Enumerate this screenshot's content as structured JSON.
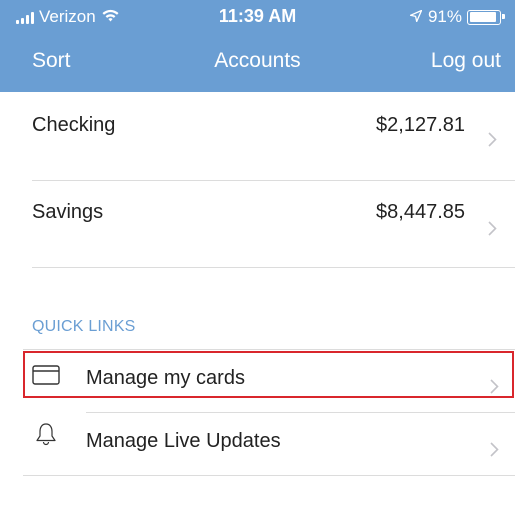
{
  "status_bar": {
    "carrier": "Verizon",
    "time": "11:39 AM",
    "battery": "91%",
    "battery_level": 0.91,
    "signal_icon": "signal-bars-icon",
    "wifi_icon": "wifi-icon",
    "location_icon": "location-arrow-icon",
    "battery_icon": "battery-icon"
  },
  "nav": {
    "left_label": "Sort",
    "title": "Accounts",
    "right_label": "Log out"
  },
  "accounts": [
    {
      "name": "Checking",
      "balance": "$2,127.81"
    },
    {
      "name": "Savings",
      "balance": "$8,447.85"
    }
  ],
  "quick_links": {
    "header": "QUICK LINKS",
    "items": [
      {
        "label": "Manage my cards",
        "icon": "credit-card-icon"
      },
      {
        "label": "Manage Live Updates",
        "icon": "bell-icon"
      }
    ]
  },
  "colors": {
    "header_bg": "#6a9ed3",
    "accent": "#6a9ed3",
    "highlight": "#d9262c"
  }
}
